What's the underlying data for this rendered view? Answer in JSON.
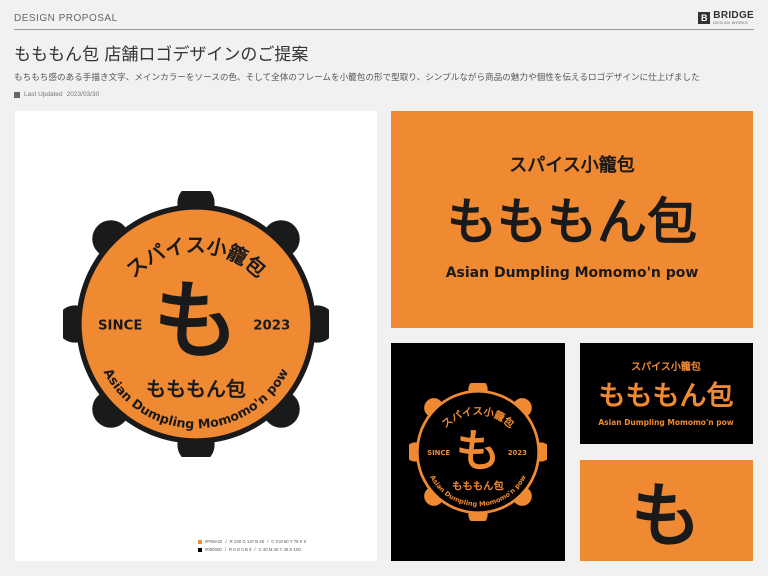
{
  "header": {
    "label": "DESIGN PROPOSAL",
    "brand_mark": "B",
    "brand_name": "BRIDGE",
    "brand_sub": "DESIGN WORKS"
  },
  "title": "もももん包 店舗ロゴデザインのご提案",
  "description": "もちもち感のある手描き文字、メインカラーをソースの色、そして全体のフレームを小籠包の形で型取り、シンプルながら商品の魅力や個性を伝えるロゴデザインに仕上げました",
  "updated": {
    "label": "Last Updated",
    "date": "2023/03/30"
  },
  "logo": {
    "arc_text": "スパイス小籠包",
    "emblem_char": "も",
    "since_label": "SINCE",
    "since_year": "2023",
    "wordmark": "もももん包",
    "english_name": "Asian Dumpling Momomo'n pow"
  },
  "colors": {
    "orange": "#f08a32",
    "black": "#000000",
    "dark_text": "#1a1a1a"
  },
  "color_specs": [
    {
      "hex": "#F08A32",
      "rgb": "R 240   G 137   B 48",
      "cmyk": "C 0   M 60   Y 78   K 0"
    },
    {
      "hex": "#000000",
      "rgb": "R 0   G 0   B 0",
      "cmyk": "C 40   M 40   Y 40   K 100"
    }
  ]
}
